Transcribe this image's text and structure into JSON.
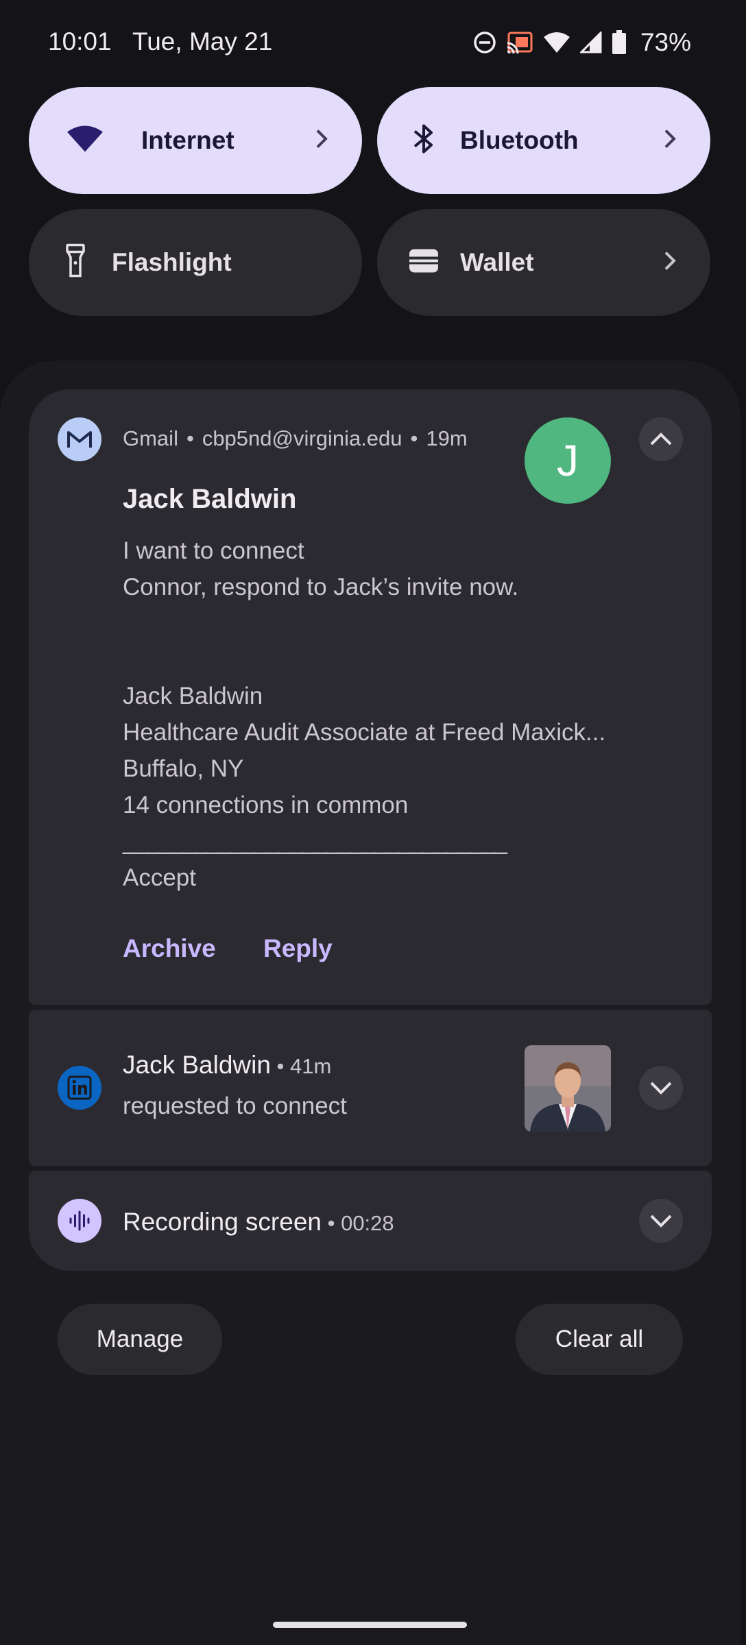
{
  "status_bar": {
    "time": "10:01",
    "date": "Tue, May 21",
    "battery_percent": "73%",
    "icons": [
      "do-not-disturb-icon",
      "cast-icon",
      "wifi-icon",
      "signal-icon",
      "battery-icon"
    ]
  },
  "quick_settings": {
    "tiles": [
      {
        "label": "Internet",
        "icon": "wifi-icon",
        "active": true
      },
      {
        "label": "Bluetooth",
        "icon": "bluetooth-icon",
        "active": true
      },
      {
        "label": "Flashlight",
        "icon": "flashlight-icon",
        "active": false
      },
      {
        "label": "Wallet",
        "icon": "wallet-icon",
        "active": false
      }
    ]
  },
  "notifications": {
    "gmail": {
      "app": "Gmail",
      "account": "cbp5nd@virginia.edu",
      "time": "19m",
      "avatar_letter": "J",
      "sender": "Jack Baldwin",
      "lines": [
        "I want to connect",
        "Connor, respond to Jack’s invite now.",
        "Jack Baldwin",
        "Healthcare Audit Associate at Freed Maxick...",
        "Buffalo, NY",
        "14 connections in common",
        "________________________________",
        "Accept"
      ],
      "actions": [
        "Archive",
        "Reply"
      ]
    },
    "linkedin": {
      "title": "Jack Baldwin",
      "time": "41m",
      "text": "requested to connect"
    },
    "recording": {
      "title": "Recording screen",
      "time": "00:28"
    }
  },
  "buttons": {
    "manage": "Manage",
    "clear_all": "Clear all"
  },
  "colors": {
    "tile_active": "#e3dcfb",
    "tile_inactive": "#2b2a2f",
    "accent_link": "#c8b8ff",
    "avatar_green": "#4fb77f",
    "linkedin_blue": "#0a66c2"
  }
}
